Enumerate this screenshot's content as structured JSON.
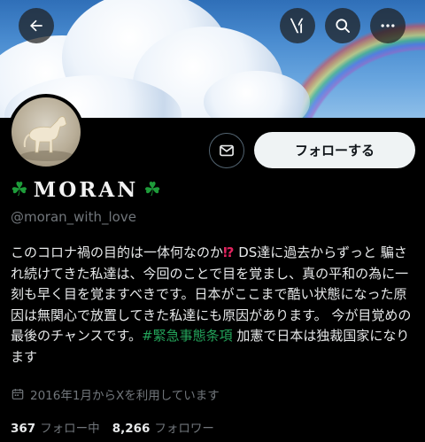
{
  "header": {
    "back_icon": "arrow-left-icon",
    "grok_icon": "grok-icon",
    "search_icon": "search-icon",
    "more_icon": "more-horizontal-icon"
  },
  "profile": {
    "display_name": "MORAN",
    "handle": "@moran_with_love",
    "follow_label": "フォローする",
    "bio_text_1": "このコロナ禍の目的は一体何なのか",
    "bio_excl": "⁉",
    "bio_text_2": " DS達に過去からずっと 騙され続けてきた私達は、今回のことで目を覚まし、真の平和の為に一刻も早く目を覚ますべきです。日本がここまで酷い状態になった原因は無関心で放置してきた私達にも原因があります。 今が目覚めの最後のチャンスです。",
    "hashtag": "#緊急事態条項",
    "bio_text_3": " 加憲で日本は独裁国家になります",
    "joined": "2016年1月からXを利用しています",
    "following_count": "367",
    "following_label": "フォロー中",
    "followers_count": "8,266",
    "followers_label": "フォロワー"
  },
  "colors": {
    "follow_bg": "#eff3f4",
    "hashtag": "#23a35a",
    "clover": "#1e9c3a",
    "muted": "#71767b"
  }
}
